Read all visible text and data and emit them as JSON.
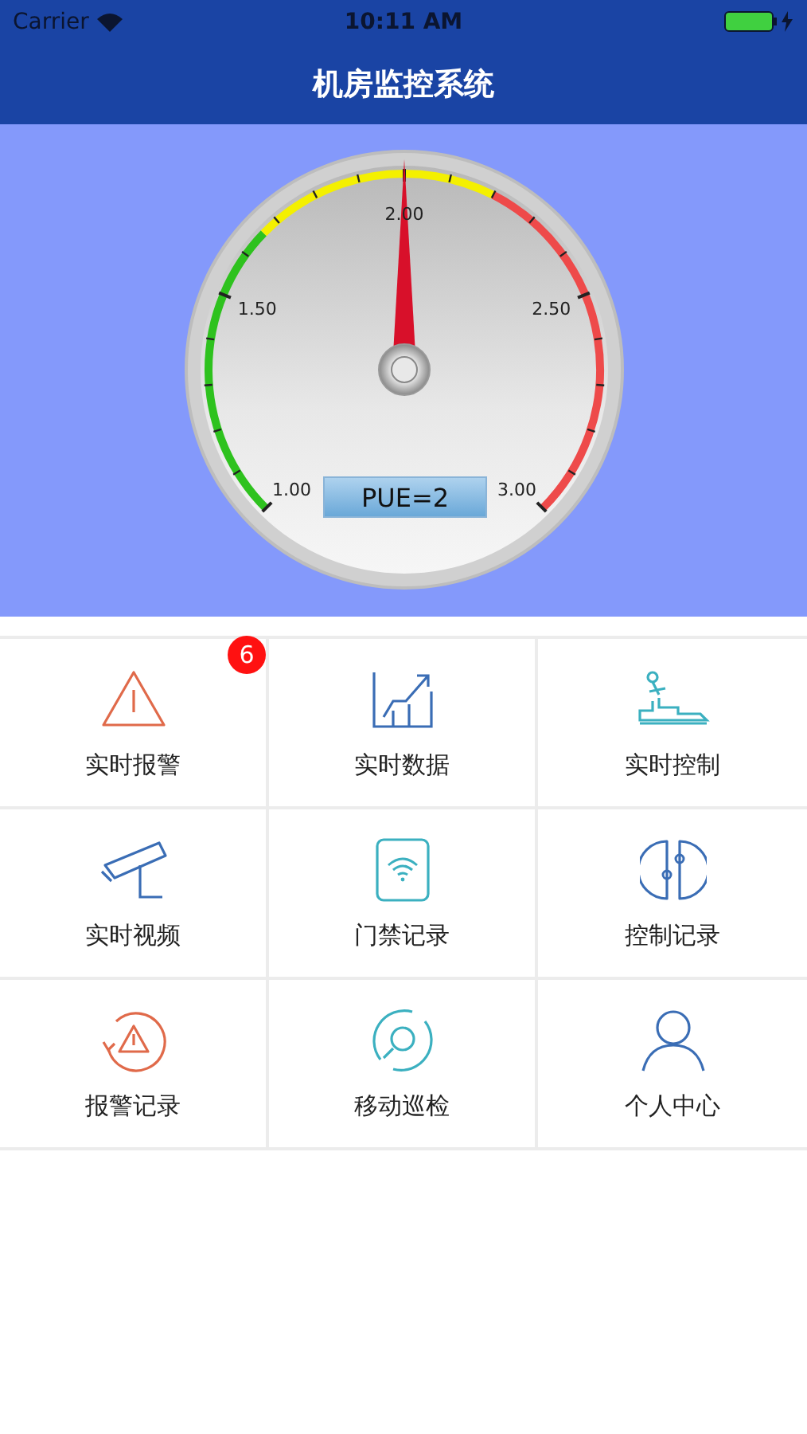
{
  "status_bar": {
    "carrier": "Carrier",
    "time": "10:11 AM"
  },
  "nav_bar": {
    "title": "机房监控系统"
  },
  "gauge": {
    "level": 0.5,
    "reading": "PUE=2",
    "tick_labels": [
      "1.00",
      "1.50",
      "2.00",
      "2.50",
      "3.00"
    ]
  },
  "menu": [
    {
      "label": "实时报警",
      "badge": "6"
    },
    {
      "label": "实时数据"
    },
    {
      "label": "实时控制"
    },
    {
      "label": "实时视频"
    },
    {
      "label": "门禁记录"
    },
    {
      "label": "控制记录"
    },
    {
      "label": "报警记录"
    },
    {
      "label": "移动巡检"
    },
    {
      "label": "个人中心"
    }
  ]
}
